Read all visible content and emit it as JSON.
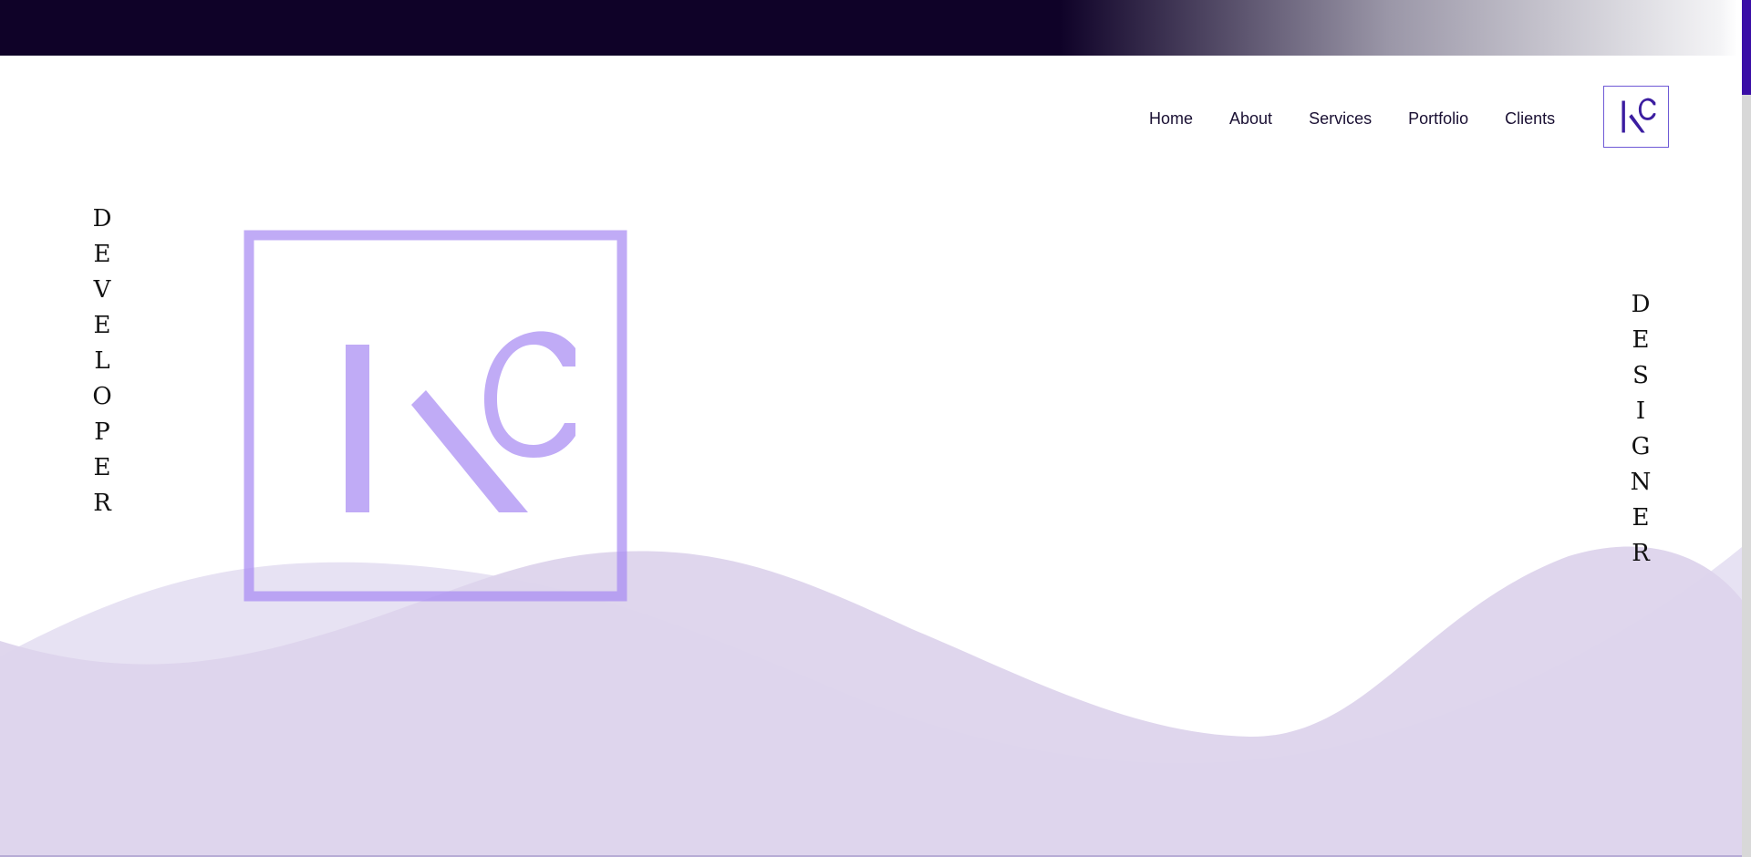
{
  "nav": {
    "items": [
      {
        "label": "Home"
      },
      {
        "label": "About"
      },
      {
        "label": "Services"
      },
      {
        "label": "Portfolio"
      },
      {
        "label": "Clients"
      }
    ],
    "logo": {
      "text": "KC",
      "icon": "kc-monogram-icon",
      "color": "#3b1da0",
      "border_color": "#6f5ad6"
    }
  },
  "hero": {
    "left_vertical_text": [
      "D",
      "E",
      "V",
      "E",
      "L",
      "O",
      "P",
      "E",
      "R"
    ],
    "right_vertical_text": [
      "D",
      "E",
      "S",
      "I",
      "G",
      "N",
      "E",
      "R"
    ],
    "logo": {
      "text": "KC",
      "icon": "kc-monogram-icon",
      "color": "#a98cf3"
    }
  },
  "colors": {
    "topbar_dark": "#0f0228",
    "wave_light": "#eeebf8",
    "wave_mid": "#dcd4ec",
    "accent": "#3a0ea6"
  }
}
